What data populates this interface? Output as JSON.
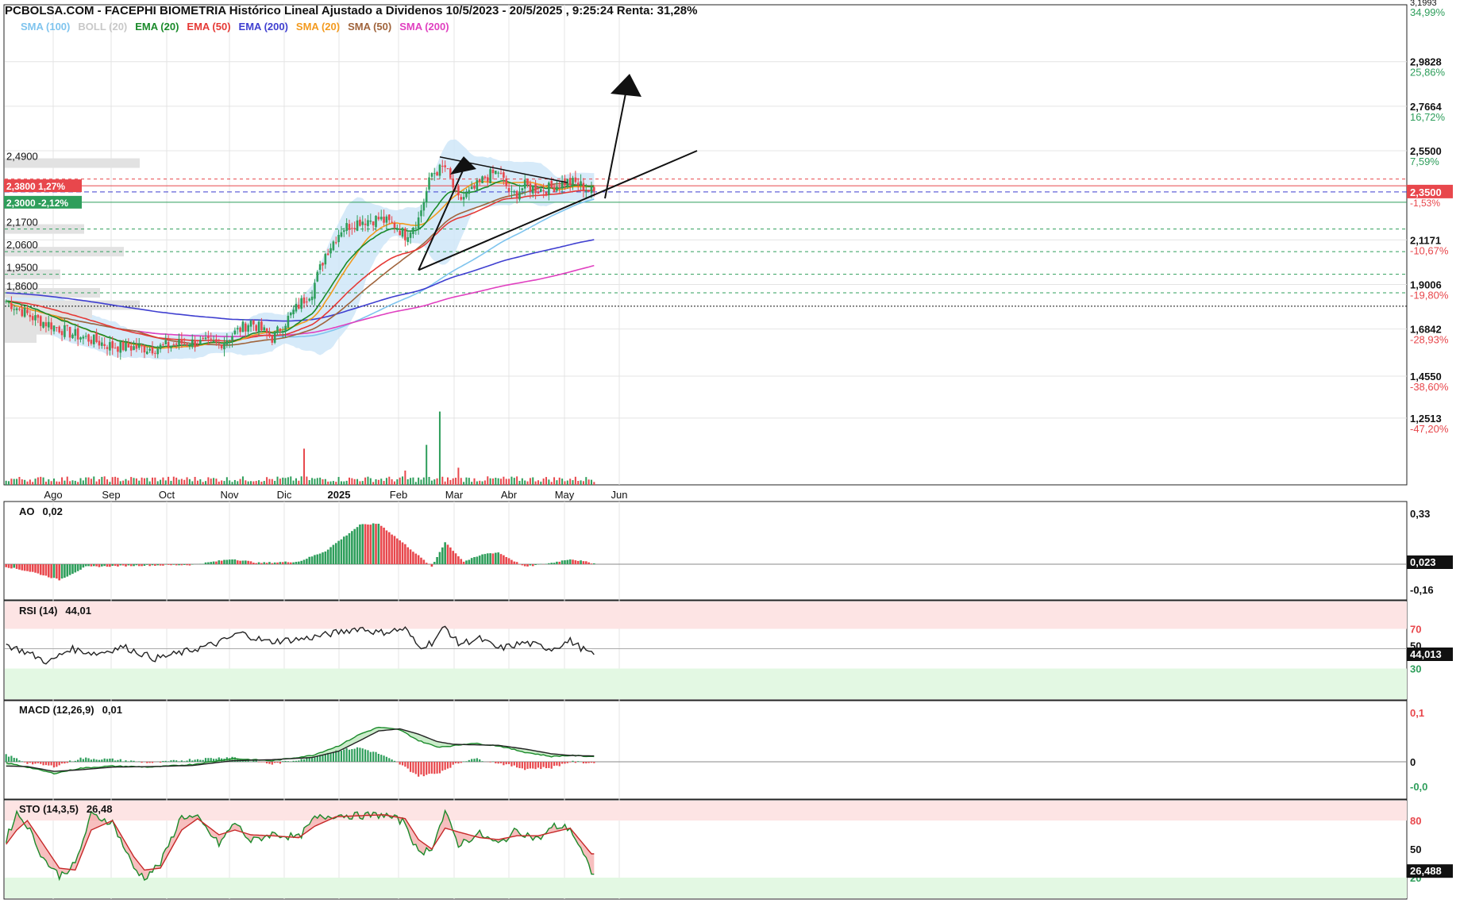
{
  "header": {
    "title": "PCBOLSA.COM - FACEPHI BIOMETRIA Histórico Lineal Ajustado a Dividenos 10/5/2023 - 20/5/2025 , 9:25:24 Renta: 31,28%"
  },
  "legend": [
    {
      "label": "SMA (100)",
      "color": "#7fc4ee"
    },
    {
      "label": "BOLL (20)",
      "color": "#c8c8c8"
    },
    {
      "label": "EMA (20)",
      "color": "#1a8a2a"
    },
    {
      "label": "EMA (50)",
      "color": "#e53935"
    },
    {
      "label": "EMA (200)",
      "color": "#3f3fd0"
    },
    {
      "label": "SMA (20)",
      "color": "#f39a1e"
    },
    {
      "label": "SMA (50)",
      "color": "#a0643c"
    },
    {
      "label": "SMA (200)",
      "color": "#e040c0"
    }
  ],
  "colors": {
    "up": "#2e9e5b",
    "down": "#e8474c",
    "bollinger_fill": "#cfe6f8",
    "grid": "#e4e4e4"
  },
  "chart_data": [
    {
      "type": "candlestick",
      "name": "price",
      "instrument": "FACEPHI BIOMETRIA",
      "x_tick_labels": [
        "Ago",
        "Sep",
        "Oct",
        "Nov",
        "Dic",
        "2025",
        "Feb",
        "Mar",
        "Abr",
        "May",
        "Jun"
      ],
      "y_axis_ticks": [
        {
          "value": "2,9828",
          "pct": "25,86%",
          "pos": 2.9828
        },
        {
          "value": "2,7664",
          "pct": "16,72%",
          "pos": 2.7664
        },
        {
          "value": "2,5500",
          "pct": "7,59%",
          "pos": 2.55
        },
        {
          "value": "2,1171",
          "pct": "-10,67%",
          "pos": 2.1171
        },
        {
          "value": "1,9006",
          "pct": "-19,80%",
          "pos": 1.9006
        },
        {
          "value": "1,6842",
          "pct": "-28,93%",
          "pos": 1.6842
        },
        {
          "value": "1,4550",
          "pct": "-38,60%",
          "pos": 1.455
        },
        {
          "value": "1,2513",
          "pct": "-47,20%",
          "pos": 1.2513
        }
      ],
      "y_axis_top_partial": {
        "value": "3,1993",
        "pct": "34,99%"
      },
      "current_price": {
        "value": "2,3500",
        "pct": "-1,53%",
        "pos": 2.35
      },
      "support_resistance_labels": [
        {
          "value": "2,4900",
          "pos": 2.49
        },
        {
          "value": "2,1700",
          "pos": 2.17
        },
        {
          "value": "2,0600",
          "pos": 2.06
        },
        {
          "value": "1,9500",
          "pos": 1.95
        },
        {
          "value": "1,8600",
          "pos": 1.86
        }
      ],
      "level_boxes": [
        {
          "text": "2,3800  1,27%",
          "pos": 2.38,
          "color": "#e8474c"
        },
        {
          "text": "2,3000  -2,12%",
          "pos": 2.3,
          "color": "#2e9e5b"
        }
      ],
      "dotted_reference": 1.795,
      "anchors": [
        [
          0,
          1.82
        ],
        [
          10,
          1.74
        ],
        [
          25,
          1.66
        ],
        [
          40,
          1.6
        ],
        [
          55,
          1.59
        ],
        [
          68,
          1.62
        ],
        [
          80,
          1.61
        ],
        [
          92,
          1.72
        ],
        [
          100,
          1.64
        ],
        [
          110,
          1.8
        ],
        [
          115,
          1.87
        ],
        [
          120,
          2.05
        ],
        [
          126,
          2.17
        ],
        [
          133,
          2.21
        ],
        [
          140,
          2.22
        ],
        [
          146,
          2.19
        ],
        [
          150,
          2.14
        ],
        [
          155,
          2.22
        ],
        [
          160,
          2.44
        ],
        [
          165,
          2.47
        ],
        [
          170,
          2.31
        ],
        [
          175,
          2.35
        ],
        [
          180,
          2.42
        ],
        [
          185,
          2.45
        ],
        [
          190,
          2.33
        ],
        [
          195,
          2.38
        ],
        [
          200,
          2.36
        ],
        [
          205,
          2.37
        ],
        [
          210,
          2.4
        ],
        [
          215,
          2.39
        ],
        [
          220,
          2.35
        ]
      ],
      "ohlc_estimate": true,
      "days": 222,
      "volume_peaks": [
        [
          112,
          0.38
        ],
        [
          158,
          0.42
        ],
        [
          163,
          0.77
        ],
        [
          150,
          0.15
        ],
        [
          170,
          0.18
        ]
      ]
    },
    {
      "type": "histogram",
      "name": "AO",
      "title": "AO",
      "value": "0,02",
      "ticks": [
        "0,33",
        "-0,16"
      ],
      "current": "0,023",
      "anchors": [
        [
          0,
          -0.02
        ],
        [
          10,
          -0.06
        ],
        [
          20,
          -0.12
        ],
        [
          30,
          -0.02
        ],
        [
          50,
          -0.01
        ],
        [
          70,
          -0.005
        ],
        [
          85,
          0.04
        ],
        [
          95,
          0.01
        ],
        [
          110,
          0.02
        ],
        [
          120,
          0.1
        ],
        [
          133,
          0.3
        ],
        [
          140,
          0.31
        ],
        [
          150,
          0.15
        ],
        [
          160,
          -0.02
        ],
        [
          165,
          0.17
        ],
        [
          172,
          0.02
        ],
        [
          180,
          0.08
        ],
        [
          185,
          0.09
        ],
        [
          195,
          -0.02
        ],
        [
          205,
          0.01
        ],
        [
          212,
          0.04
        ],
        [
          220,
          0.01
        ]
      ]
    },
    {
      "type": "line",
      "name": "RSI",
      "title": "RSI (14)",
      "value": "44,01",
      "ticks": [
        "70",
        "50",
        "30"
      ],
      "current": "44,013",
      "anchors": [
        [
          0,
          54
        ],
        [
          8,
          46
        ],
        [
          16,
          36
        ],
        [
          24,
          50
        ],
        [
          34,
          45
        ],
        [
          44,
          52
        ],
        [
          56,
          40
        ],
        [
          66,
          46
        ],
        [
          80,
          56
        ],
        [
          88,
          66
        ],
        [
          98,
          57
        ],
        [
          112,
          60
        ],
        [
          120,
          64
        ],
        [
          133,
          71
        ],
        [
          140,
          66
        ],
        [
          150,
          70
        ],
        [
          155,
          52
        ],
        [
          160,
          56
        ],
        [
          165,
          72
        ],
        [
          170,
          55
        ],
        [
          178,
          60
        ],
        [
          185,
          50
        ],
        [
          195,
          56
        ],
        [
          205,
          50
        ],
        [
          212,
          58
        ],
        [
          220,
          44
        ]
      ]
    },
    {
      "type": "line",
      "name": "MACD",
      "title": "MACD (12,26,9)",
      "value": "0,01",
      "ticks": [
        "0,1",
        "0",
        "-0,0"
      ],
      "macd_anchors": [
        [
          0,
          -0.002
        ],
        [
          8,
          -0.01
        ],
        [
          18,
          -0.022
        ],
        [
          28,
          -0.012
        ],
        [
          40,
          -0.008
        ],
        [
          55,
          -0.01
        ],
        [
          70,
          -0.005
        ],
        [
          85,
          0.006
        ],
        [
          100,
          0.002
        ],
        [
          115,
          0.012
        ],
        [
          125,
          0.03
        ],
        [
          133,
          0.052
        ],
        [
          140,
          0.065
        ],
        [
          148,
          0.06
        ],
        [
          155,
          0.04
        ],
        [
          162,
          0.028
        ],
        [
          168,
          0.03
        ],
        [
          175,
          0.035
        ],
        [
          185,
          0.03
        ],
        [
          195,
          0.018
        ],
        [
          205,
          0.01
        ],
        [
          212,
          0.012
        ],
        [
          220,
          0.01
        ]
      ],
      "signal_anchors": [
        [
          0,
          -0.008
        ],
        [
          8,
          -0.009
        ],
        [
          18,
          -0.018
        ],
        [
          28,
          -0.015
        ],
        [
          40,
          -0.01
        ],
        [
          55,
          -0.009
        ],
        [
          70,
          -0.007
        ],
        [
          85,
          0.002
        ],
        [
          100,
          0.004
        ],
        [
          115,
          0.008
        ],
        [
          125,
          0.02
        ],
        [
          133,
          0.04
        ],
        [
          140,
          0.058
        ],
        [
          148,
          0.062
        ],
        [
          155,
          0.052
        ],
        [
          162,
          0.038
        ],
        [
          168,
          0.033
        ],
        [
          175,
          0.032
        ],
        [
          185,
          0.031
        ],
        [
          195,
          0.024
        ],
        [
          205,
          0.015
        ],
        [
          212,
          0.012
        ],
        [
          220,
          0.011
        ]
      ]
    },
    {
      "type": "line",
      "name": "STO",
      "title": "STO (14,3,5)",
      "value": "26,48",
      "ticks": [
        "80",
        "50",
        "20"
      ],
      "current": "26,488",
      "k_anchors": [
        [
          0,
          60
        ],
        [
          4,
          88
        ],
        [
          8,
          75
        ],
        [
          14,
          40
        ],
        [
          20,
          22
        ],
        [
          26,
          34
        ],
        [
          32,
          86
        ],
        [
          40,
          78
        ],
        [
          48,
          30
        ],
        [
          52,
          20
        ],
        [
          58,
          35
        ],
        [
          66,
          85
        ],
        [
          72,
          82
        ],
        [
          80,
          55
        ],
        [
          86,
          78
        ],
        [
          92,
          58
        ],
        [
          100,
          66
        ],
        [
          110,
          62
        ],
        [
          116,
          82
        ],
        [
          124,
          86
        ],
        [
          132,
          85
        ],
        [
          142,
          86
        ],
        [
          150,
          78
        ],
        [
          155,
          45
        ],
        [
          160,
          52
        ],
        [
          165,
          88
        ],
        [
          170,
          55
        ],
        [
          178,
          66
        ],
        [
          185,
          55
        ],
        [
          192,
          70
        ],
        [
          200,
          60
        ],
        [
          206,
          74
        ],
        [
          212,
          72
        ],
        [
          220,
          26
        ]
      ],
      "d_anchors": [
        [
          0,
          55
        ],
        [
          4,
          70
        ],
        [
          8,
          80
        ],
        [
          14,
          55
        ],
        [
          20,
          30
        ],
        [
          26,
          28
        ],
        [
          32,
          70
        ],
        [
          40,
          80
        ],
        [
          48,
          42
        ],
        [
          52,
          28
        ],
        [
          58,
          30
        ],
        [
          66,
          70
        ],
        [
          72,
          82
        ],
        [
          80,
          65
        ],
        [
          86,
          70
        ],
        [
          92,
          65
        ],
        [
          100,
          64
        ],
        [
          110,
          62
        ],
        [
          116,
          74
        ],
        [
          124,
          84
        ],
        [
          132,
          85
        ],
        [
          142,
          86
        ],
        [
          150,
          82
        ],
        [
          155,
          60
        ],
        [
          160,
          50
        ],
        [
          165,
          72
        ],
        [
          170,
          68
        ],
        [
          178,
          62
        ],
        [
          185,
          60
        ],
        [
          192,
          64
        ],
        [
          200,
          64
        ],
        [
          206,
          68
        ],
        [
          212,
          72
        ],
        [
          220,
          45
        ]
      ]
    }
  ]
}
